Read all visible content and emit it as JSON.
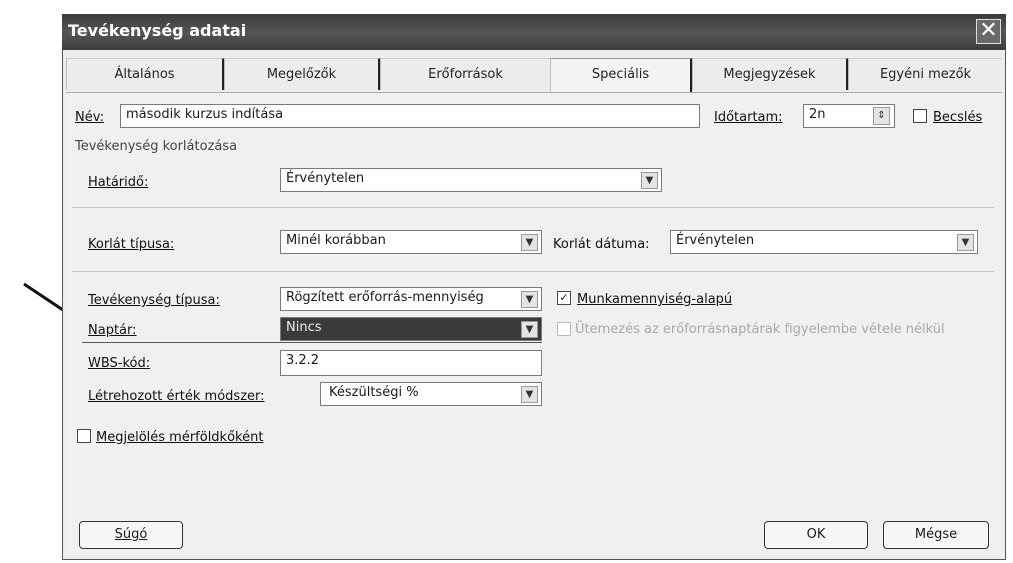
{
  "window": {
    "title": "Tevékenység adatai",
    "close_icon": "close-icon"
  },
  "tabs": [
    {
      "label": "Általános"
    },
    {
      "label": "Megelőzők"
    },
    {
      "label": "Erőforrások"
    },
    {
      "label": "Speciális",
      "active": true
    },
    {
      "label": "Megjegyzések"
    },
    {
      "label": "Egyéni mezők"
    }
  ],
  "name": {
    "label": "Név:",
    "value": "második kurzus indítása"
  },
  "duration": {
    "label": "Időtartam:",
    "value": "2n",
    "estimate_label": "Becslés",
    "estimate_checked": false
  },
  "constraint_group": {
    "label": "Tevékenység korlátozása"
  },
  "deadline": {
    "label": "Határidő:",
    "value": "Érvénytelen"
  },
  "constraint_type": {
    "label": "Korlát típusa:",
    "value": "Minél korábban"
  },
  "constraint_date": {
    "label": "Korlát dátuma:",
    "value": "Érvénytelen"
  },
  "task_type": {
    "label": "Tevékenység típusa:",
    "value": "Rögzített erőforrás-mennyiség"
  },
  "effort_driven": {
    "label": "Munkamennyiség-alapú",
    "checked": true
  },
  "calendar": {
    "label": "Naptár:",
    "value": "Nincs"
  },
  "ignore_resource_calendars": {
    "label": "Ütemezés az erőforrásnaptárak figyelembe vétele nélkül",
    "checked": false,
    "disabled": true
  },
  "wbs": {
    "label": "WBS-kód:",
    "value": "3.2.2"
  },
  "earned_value": {
    "label": "Létrehozott érték módszer:",
    "value": "Készültségi %"
  },
  "milestone": {
    "label": "Megjelölés mérföldkőként",
    "checked": false
  },
  "buttons": {
    "help": "Súgó",
    "ok": "OK",
    "cancel": "Mégse"
  },
  "colors": {
    "titlebar": "#3f3f3f",
    "dialog_bg": "#efefef",
    "selected_field": "#3a3a3a"
  }
}
